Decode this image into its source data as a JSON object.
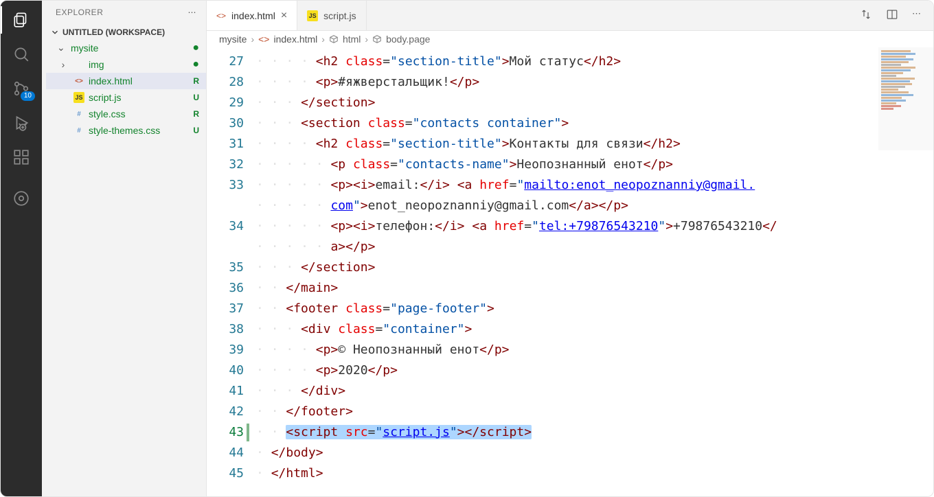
{
  "sidebar": {
    "title": "EXPLORER",
    "workspace": "UNTITLED (WORKSPACE)",
    "root": "mysite",
    "items": [
      {
        "label": "img",
        "icon": "folder",
        "status": "●",
        "chev": "›"
      },
      {
        "label": "index.html",
        "icon": "html",
        "status": "R"
      },
      {
        "label": "script.js",
        "icon": "js",
        "status": "U"
      },
      {
        "label": "style.css",
        "icon": "css",
        "status": "R"
      },
      {
        "label": "style-themes.css",
        "icon": "css",
        "status": "U"
      }
    ],
    "scm_badge": "10"
  },
  "tabs": [
    {
      "label": "index.html",
      "icon": "html",
      "active": true
    },
    {
      "label": "script.js",
      "icon": "js",
      "active": false
    }
  ],
  "breadcrumb": {
    "folder": "mysite",
    "file": "index.html",
    "el1": "html",
    "el2": "body.page"
  },
  "code": {
    "first_line": 27,
    "lines": [
      {
        "n": 27,
        "indent": 4,
        "html": "<span class='t'>&lt;h2</span> <span class='attr'>class</span>=<span class='str'>\"section-title\"</span><span class='t'>&gt;</span><span class='txt'>Мой статус</span><span class='t'>&lt;/h2&gt;</span>"
      },
      {
        "n": 28,
        "indent": 4,
        "html": "<span class='t'>&lt;p&gt;</span><span class='txt'>#яжверстальщик!</span><span class='t'>&lt;/p&gt;</span>"
      },
      {
        "n": 29,
        "indent": 3,
        "html": "<span class='t'>&lt;/section&gt;</span>"
      },
      {
        "n": 30,
        "indent": 3,
        "html": "<span class='t'>&lt;section</span> <span class='attr'>class</span>=<span class='str'>\"contacts container\"</span><span class='t'>&gt;</span>"
      },
      {
        "n": 31,
        "indent": 4,
        "html": "<span class='t'>&lt;h2</span> <span class='attr'>class</span>=<span class='str'>\"section-title\"</span><span class='t'>&gt;</span><span class='txt'>Контакты для связи</span><span class='t'>&lt;/h2&gt;</span>"
      },
      {
        "n": 32,
        "indent": 5,
        "html": "<span class='t'>&lt;p</span> <span class='attr'>class</span>=<span class='str'>\"contacts-name\"</span><span class='t'>&gt;</span><span class='txt'>Неопознанный енот</span><span class='t'>&lt;/p&gt;</span>"
      },
      {
        "n": 33,
        "indent": 5,
        "html": "<span class='t'>&lt;p&gt;&lt;i&gt;</span><span class='txt'>email:</span><span class='t'>&lt;/i&gt;</span> <span class='t'>&lt;a</span> <span class='attr'>href</span>=<span class='str'>\"</span><span class='url'>mailto:enot_neopoznanniy@gmail.</span>"
      },
      {
        "n": "33b",
        "indent": 5,
        "cont": true,
        "html": "<span class='url'>com</span><span class='str'>\"</span><span class='t'>&gt;</span><span class='txt'>enot_neopoznanniy@gmail.com</span><span class='t'>&lt;/a&gt;&lt;/p&gt;</span>"
      },
      {
        "n": 34,
        "indent": 5,
        "html": "<span class='t'>&lt;p&gt;&lt;i&gt;</span><span class='txt'>телефон:</span><span class='t'>&lt;/i&gt;</span> <span class='t'>&lt;a</span> <span class='attr'>href</span>=<span class='str'>\"</span><span class='url'>tel:+79876543210</span><span class='str'>\"</span><span class='t'>&gt;</span><span class='txt'>+79876543210</span><span class='t'>&lt;/</span>"
      },
      {
        "n": "34b",
        "indent": 5,
        "cont": true,
        "html": "<span class='t'>a&gt;&lt;/p&gt;</span>"
      },
      {
        "n": 35,
        "indent": 3,
        "html": "<span class='t'>&lt;/section&gt;</span>"
      },
      {
        "n": 36,
        "indent": 2,
        "html": "<span class='t'>&lt;/main&gt;</span>"
      },
      {
        "n": 37,
        "indent": 2,
        "html": "<span class='t'>&lt;footer</span> <span class='attr'>class</span>=<span class='str'>\"page-footer\"</span><span class='t'>&gt;</span>"
      },
      {
        "n": 38,
        "indent": 3,
        "html": "<span class='t'>&lt;div</span> <span class='attr'>class</span>=<span class='str'>\"container\"</span><span class='t'>&gt;</span>"
      },
      {
        "n": 39,
        "indent": 4,
        "html": "<span class='t'>&lt;p&gt;</span><span class='txt'>© Неопознанный енот</span><span class='t'>&lt;/p&gt;</span>"
      },
      {
        "n": 40,
        "indent": 4,
        "html": "<span class='t'>&lt;p&gt;</span><span class='txt'>2020</span><span class='t'>&lt;/p&gt;</span>"
      },
      {
        "n": 41,
        "indent": 3,
        "html": "<span class='t'>&lt;/div&gt;</span>"
      },
      {
        "n": 42,
        "indent": 2,
        "html": "<span class='t'>&lt;/footer&gt;</span>"
      },
      {
        "n": 43,
        "indent": 2,
        "mod": true,
        "sel": true,
        "html": "<span class='t'>&lt;script</span> <span class='attr'>src</span>=<span class='str'>\"</span><span class='url'>script.js</span><span class='str'>\"</span><span class='t'>&gt;&lt;/script&gt;</span>"
      },
      {
        "n": 44,
        "indent": 1,
        "html": "<span class='t'>&lt;/body&gt;</span>"
      },
      {
        "n": 45,
        "indent": 1,
        "html": "<span class='t'>&lt;/html&gt;</span>"
      }
    ]
  }
}
